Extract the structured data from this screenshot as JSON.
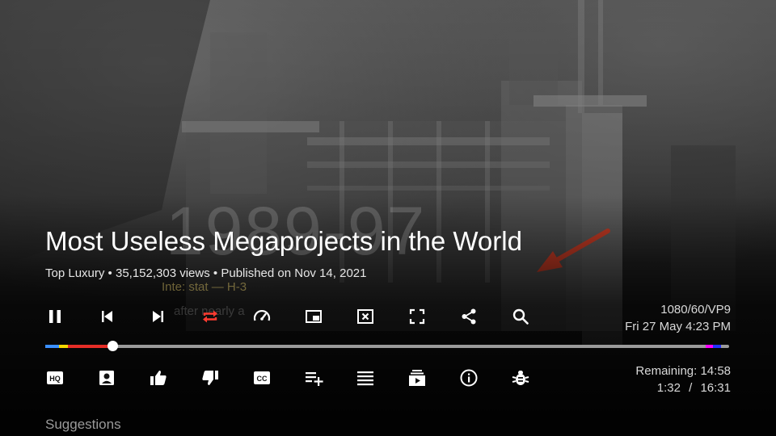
{
  "video": {
    "title": "Most Useless Megaprojects in the World",
    "channel": "Top Luxury",
    "views": "35,152,303 views",
    "published": "Published on Nov 14, 2021",
    "meta_separator": "•"
  },
  "background_overlay": {
    "year_text": "1989-97",
    "subtitle_1": "Inte: stat — H-3",
    "subtitle_2": "after nearly a"
  },
  "status": {
    "format": "1080/60/VP9",
    "datetime": "Fri 27 May 4:23 PM",
    "remaining": "Remaining: 14:58",
    "elapsed": "1:32",
    "time_separator": "/",
    "duration": "16:31"
  },
  "progress": {
    "played_fraction": 0.099,
    "colors": {
      "played": "#e52d27",
      "track": "#9a9a9a",
      "knob": "#ffffff",
      "active_icon": "#ff3b30"
    },
    "markers": [
      {
        "color": "#3b8fff",
        "start": 0.0,
        "end": 0.02
      },
      {
        "color": "#f5d800",
        "start": 0.02,
        "end": 0.033
      },
      {
        "color": "#e52d27",
        "start": 0.033,
        "end": 0.099
      },
      {
        "color": "#ff00ff",
        "start": 0.966,
        "end": 0.976
      },
      {
        "color": "#2233ff",
        "start": 0.976,
        "end": 0.988
      }
    ]
  },
  "controls_row1": [
    {
      "name": "pause-button",
      "icon": "pause-icon"
    },
    {
      "name": "previous-button",
      "icon": "skip-previous-icon"
    },
    {
      "name": "next-button",
      "icon": "skip-next-icon"
    },
    {
      "name": "repeat-button",
      "icon": "repeat-icon",
      "active": true
    },
    {
      "name": "speed-button",
      "icon": "speedometer-icon"
    },
    {
      "name": "picture-in-picture-button",
      "icon": "pip-icon"
    },
    {
      "name": "close-player-button",
      "icon": "close-box-icon"
    },
    {
      "name": "fullscreen-button",
      "icon": "fullscreen-icon"
    },
    {
      "name": "share-button",
      "icon": "share-icon"
    },
    {
      "name": "search-button",
      "icon": "search-icon"
    }
  ],
  "controls_row2": [
    {
      "name": "quality-button",
      "icon": "hq-icon"
    },
    {
      "name": "channel-button",
      "icon": "account-box-icon"
    },
    {
      "name": "like-button",
      "icon": "thumb-up-icon"
    },
    {
      "name": "dislike-button",
      "icon": "thumb-down-icon"
    },
    {
      "name": "captions-button",
      "icon": "closed-captions-icon"
    },
    {
      "name": "add-to-playlist-button",
      "icon": "playlist-add-icon"
    },
    {
      "name": "playlist-button",
      "icon": "list-icon"
    },
    {
      "name": "subscriptions-button",
      "icon": "subscriptions-icon"
    },
    {
      "name": "info-button",
      "icon": "info-icon"
    },
    {
      "name": "debug-button",
      "icon": "bug-icon"
    }
  ],
  "icon_labels": {
    "hq": "HQ",
    "cc": "CC"
  },
  "suggestions": {
    "label": "Suggestions"
  }
}
